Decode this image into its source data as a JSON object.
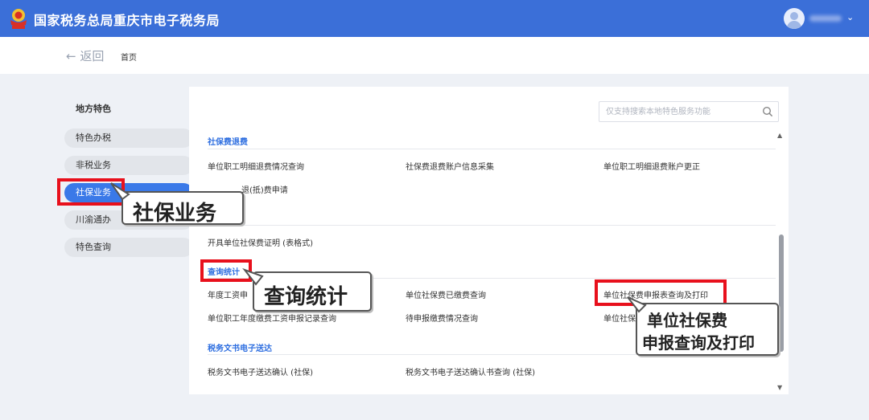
{
  "header": {
    "title": "国家税务总局重庆市电子税务局",
    "user_chevron": "⌄"
  },
  "breadcrumb": {
    "back_label": "← 返回",
    "home_label": "首页"
  },
  "sidebar": {
    "heading": "地方特色",
    "items": [
      {
        "label": "特色办税"
      },
      {
        "label": "非税业务"
      },
      {
        "label": "社保业务",
        "active": true
      },
      {
        "label": "川渝通办"
      },
      {
        "label": "特色查询"
      }
    ]
  },
  "search": {
    "placeholder": "仅支持搜索本地特色服务功能"
  },
  "sections": [
    {
      "title": "社保费退费",
      "links": [
        "单位职工明细退费情况查询",
        "社保费退费账户信息采集",
        "单位职工明细退费账户更正",
        "退(抵)费申请"
      ]
    },
    {
      "title": "",
      "links": [
        "开具单位社保费证明 (表格式)"
      ]
    },
    {
      "title": "查询统计",
      "links": [
        "年度工资申",
        "单位社保费已缴费查询",
        "单位社保费申报表查询及打印",
        "单位职工年度缴费工资申报记录查询",
        "待申报缴费情况查询",
        "单位社保"
      ]
    },
    {
      "title": "税务文书电子送达",
      "links": [
        "税务文书电子送达确认 (社保)",
        "税务文书电子送达确认书查询 (社保)"
      ]
    }
  ],
  "annotations": {
    "callout1": "社保业务",
    "callout2": "查询统计",
    "callout3_line1": "单位社保费",
    "callout3_line2": "申报查询及打印"
  },
  "colors": {
    "header": "#3b6fd8",
    "accent": "#2f6fe0",
    "highlight": "#e8101c"
  }
}
